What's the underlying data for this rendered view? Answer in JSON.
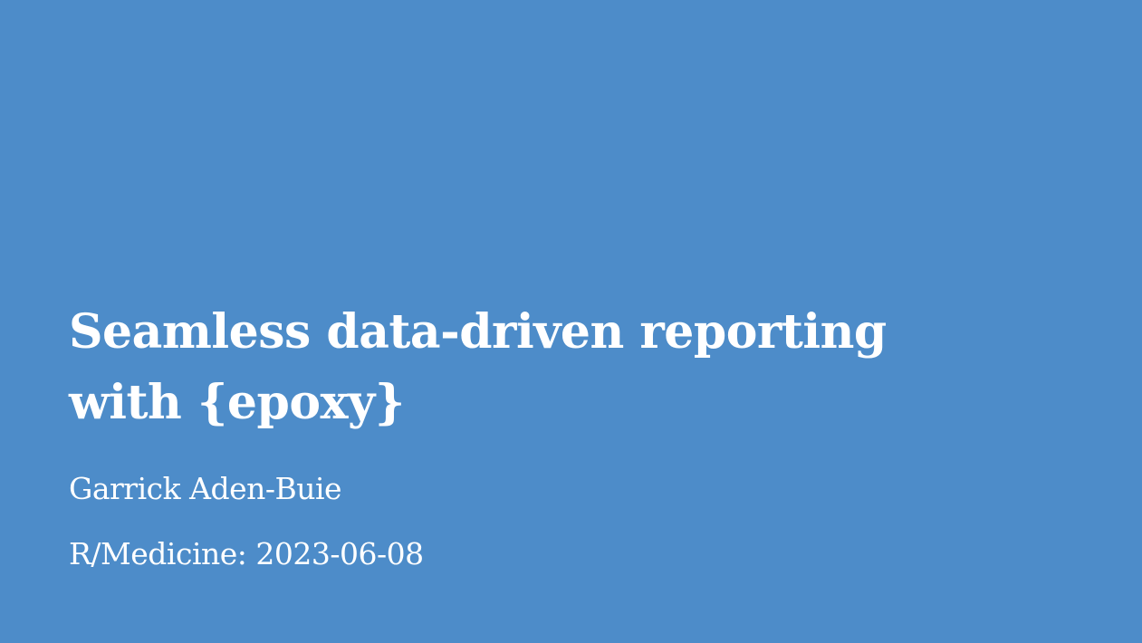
{
  "slide": {
    "title_lines": [
      "Seamless data-driven reporting",
      "with {epoxy}"
    ],
    "author": "Garrick Aden-Buie",
    "event": "R/Medicine: 2023-06-08"
  },
  "colors": {
    "background": "#4d8cc9",
    "text": "#ffffff"
  }
}
